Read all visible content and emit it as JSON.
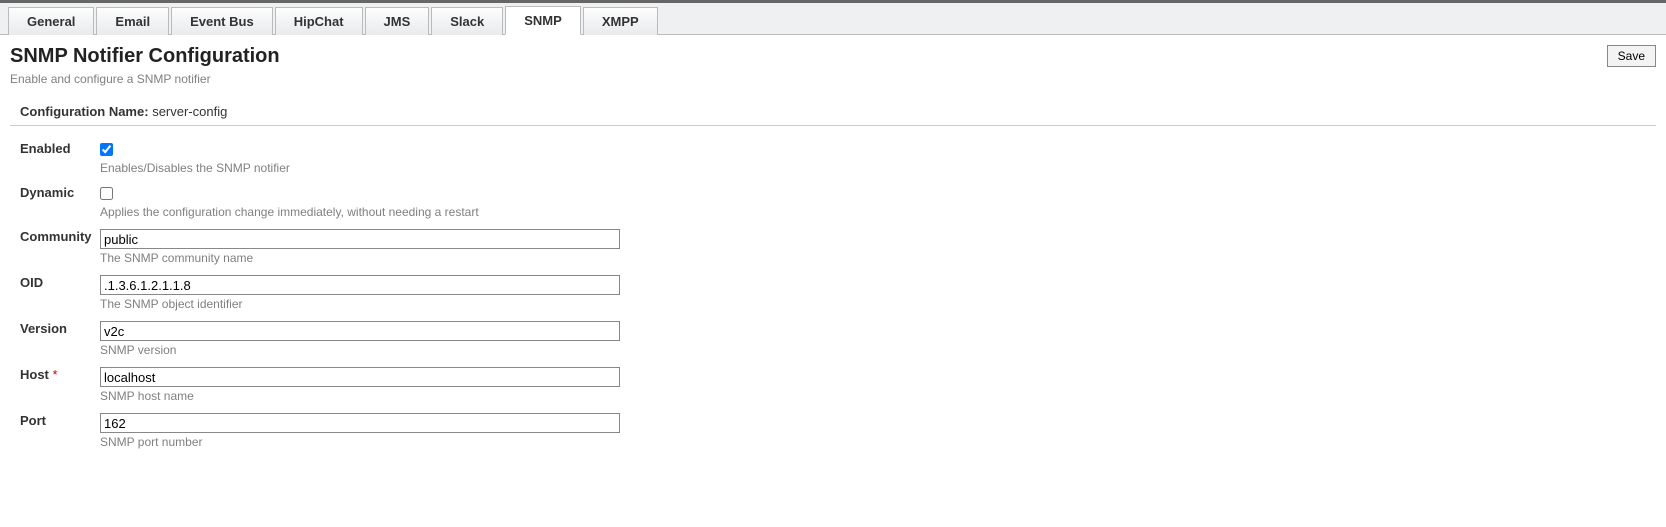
{
  "tabs": {
    "items": [
      "General",
      "Email",
      "Event Bus",
      "HipChat",
      "JMS",
      "Slack",
      "SNMP",
      "XMPP"
    ],
    "active_index": 6
  },
  "page": {
    "title": "SNMP Notifier Configuration",
    "subtitle": "Enable and configure a SNMP notifier",
    "save_label": "Save"
  },
  "config": {
    "name_label": "Configuration Name:",
    "name_value": "server-config"
  },
  "fields": {
    "enabled": {
      "label": "Enabled",
      "checked": true,
      "help": "Enables/Disables the SNMP notifier"
    },
    "dynamic": {
      "label": "Dynamic",
      "checked": false,
      "help": "Applies the configuration change immediately, without needing a restart"
    },
    "community": {
      "label": "Community",
      "value": "public",
      "help": "The SNMP community name"
    },
    "oid": {
      "label": "OID",
      "value": ".1.3.6.1.2.1.1.8",
      "help": "The SNMP object identifier"
    },
    "version": {
      "label": "Version",
      "value": "v2c",
      "help": "SNMP version"
    },
    "host": {
      "label": "Host",
      "required": true,
      "value": "localhost",
      "help": "SNMP host name"
    },
    "port": {
      "label": "Port",
      "value": "162",
      "help": "SNMP port number"
    }
  }
}
